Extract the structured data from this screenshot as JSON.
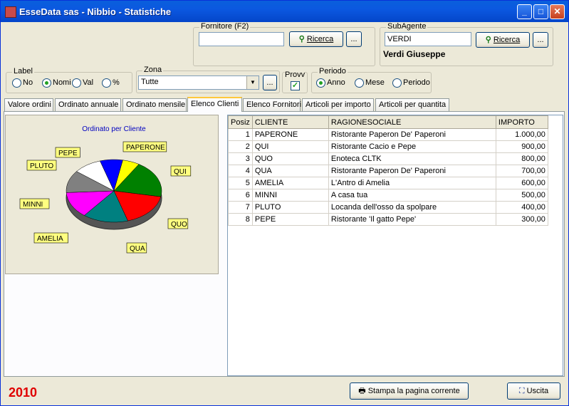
{
  "window": {
    "title": "EsseData sas - Nibbio - Statistiche"
  },
  "fornitore": {
    "label": "Fornitore (F2)",
    "value": "",
    "search_label": "Ricerca",
    "dots": "..."
  },
  "subagente": {
    "label": "SubAgente",
    "value": "VERDI",
    "search_label": "Ricerca",
    "dots": "...",
    "name": "Verdi Giuseppe"
  },
  "label_group": {
    "title": "Label",
    "options": [
      "No",
      "Nomi",
      "Val",
      "%"
    ],
    "selected": "Nomi"
  },
  "zona": {
    "title": "Zona",
    "value": "Tutte",
    "dots": "..."
  },
  "provv": {
    "label": "Provv",
    "checked": true
  },
  "periodo": {
    "title": "Periodo",
    "options": [
      "Anno",
      "Mese",
      "Periodo"
    ],
    "selected": "Anno"
  },
  "tabs": [
    {
      "label": "Valore ordini"
    },
    {
      "label": "Ordinato annuale"
    },
    {
      "label": "Ordinato mensile"
    },
    {
      "label": "Elenco Clienti",
      "active": true
    },
    {
      "label": "Elenco Fornitori"
    },
    {
      "label": "Articoli per importo"
    },
    {
      "label": "Articoli per quantita"
    }
  ],
  "chart_data": {
    "type": "pie",
    "title": "Ordinato per Cliente",
    "categories": [
      "PAPERONE",
      "QUI",
      "QUO",
      "QUA",
      "AMELIA",
      "MINNI",
      "PLUTO",
      "PEPE"
    ],
    "values": [
      1000,
      900,
      800,
      700,
      600,
      500,
      400,
      300
    ],
    "colors": [
      "#008000",
      "#ff0000",
      "#008080",
      "#ff00ff",
      "#808080",
      "#ffffff",
      "#0000ff",
      "#ffff00"
    ]
  },
  "grid": {
    "columns": [
      "Posiz",
      "CLIENTE",
      "RAGIONESOCIALE",
      "IMPORTO"
    ],
    "rows": [
      [
        "1",
        "PAPERONE",
        "Ristorante Paperon De' Paperoni",
        "1.000,00"
      ],
      [
        "2",
        "QUI",
        "Ristorante Cacio e Pepe",
        "900,00"
      ],
      [
        "3",
        "QUO",
        "Enoteca CLTK",
        "800,00"
      ],
      [
        "4",
        "QUA",
        "Ristorante Paperon De' Paperoni",
        "700,00"
      ],
      [
        "5",
        "AMELIA",
        "L'Antro di Amelia",
        "600,00"
      ],
      [
        "6",
        "MINNI",
        "A casa tua",
        "500,00"
      ],
      [
        "7",
        "PLUTO",
        "Locanda dell'osso da spolpare",
        "400,00"
      ],
      [
        "8",
        "PEPE",
        "Ristorante 'Il gatto Pepe'",
        "300,00"
      ]
    ]
  },
  "footer": {
    "year": "2010",
    "print_label": "Stampa la pagina corrente",
    "exit_label": "Uscita"
  }
}
